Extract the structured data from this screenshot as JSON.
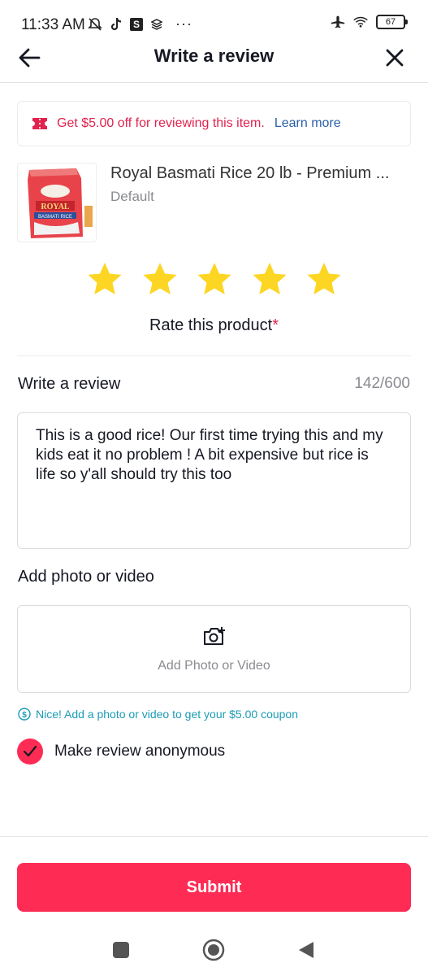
{
  "status_bar": {
    "time": "11:33 AM",
    "left_icons": [
      "muted-notification-icon",
      "tiktok-icon",
      "s-app-icon",
      "stack-icon"
    ],
    "s_badge": "S",
    "more": "···",
    "right_icons": [
      "airplane-icon",
      "wifi-icon"
    ],
    "battery": "67"
  },
  "header": {
    "title": "Write a review",
    "back_icon": "arrow-left-icon",
    "close_icon": "close-icon"
  },
  "coupon": {
    "text": "Get $5.00 off for reviewing this item.",
    "link": "Learn more",
    "icon": "ticket-icon"
  },
  "product": {
    "title": "Royal Basmati Rice 20 lb - Premium ...",
    "variant": "Default",
    "thumb_label": "ROYAL",
    "thumb_sub": "BASMATI RICE"
  },
  "rating": {
    "stars": 5,
    "max": 5,
    "label": "Rate this product",
    "required_mark": "*",
    "star_color": "#fdd523"
  },
  "review": {
    "label": "Write a review",
    "counter": "142/600",
    "text": "This is a good rice! Our first time trying this and my kids eat it no problem ! A bit expensive but rice is life so y'all should try this too"
  },
  "media": {
    "label": "Add photo or video",
    "button_text": "Add Photo or Video",
    "icon": "camera-plus-icon"
  },
  "hint": {
    "icon": "dollar-circle-icon",
    "text": "Nice! Add a photo or video to get your $5.00 coupon"
  },
  "anonymous": {
    "checked": true,
    "label": "Make review anonymous"
  },
  "submit": {
    "label": "Submit",
    "color": "#fe2c55"
  },
  "colors": {
    "accent": "#fe2c55",
    "coupon_text": "#e0234e",
    "link": "#2a5fa8",
    "hint": "#1b9bb5"
  }
}
